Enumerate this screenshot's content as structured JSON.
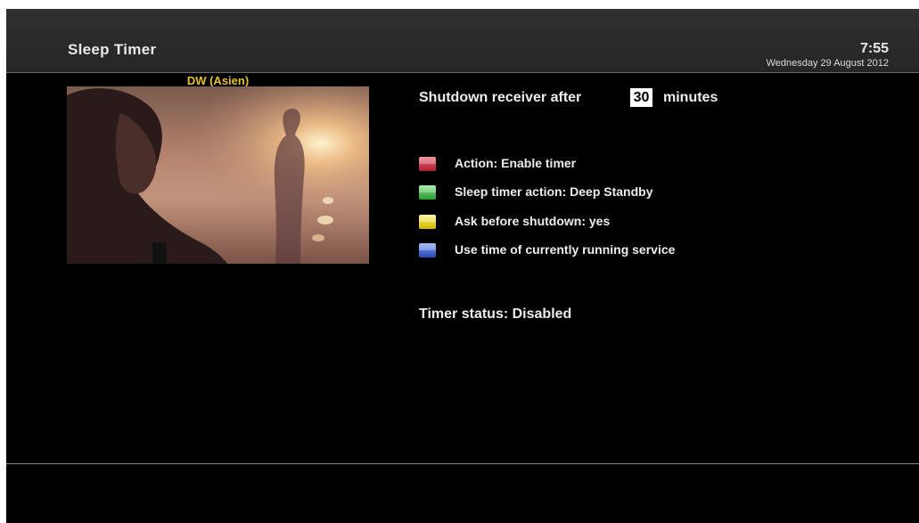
{
  "header": {
    "title": "Sleep Timer",
    "time": "7:55",
    "date": "Wednesday 29 August 2012"
  },
  "preview": {
    "channel": "DW (Asien)"
  },
  "settings": {
    "shutdown_label": "Shutdown receiver after",
    "minutes_value": "30",
    "minutes_unit": "minutes"
  },
  "options": [
    {
      "key": "red",
      "label": "Action: Enable timer"
    },
    {
      "key": "green",
      "label": "Sleep timer action: Deep Standby"
    },
    {
      "key": "yellow",
      "label": "Ask before shutdown: yes"
    },
    {
      "key": "blue",
      "label": "Use time of currently running service"
    }
  ],
  "status": {
    "text": "Timer status: Disabled"
  },
  "colors": {
    "background": "#000000",
    "header": "#2c2c2c",
    "channel_name": "#e6c230",
    "red_key": "#c0283c",
    "green_key": "#3fae45",
    "yellow_key": "#e8d21e",
    "blue_key": "#3a5ccc"
  }
}
